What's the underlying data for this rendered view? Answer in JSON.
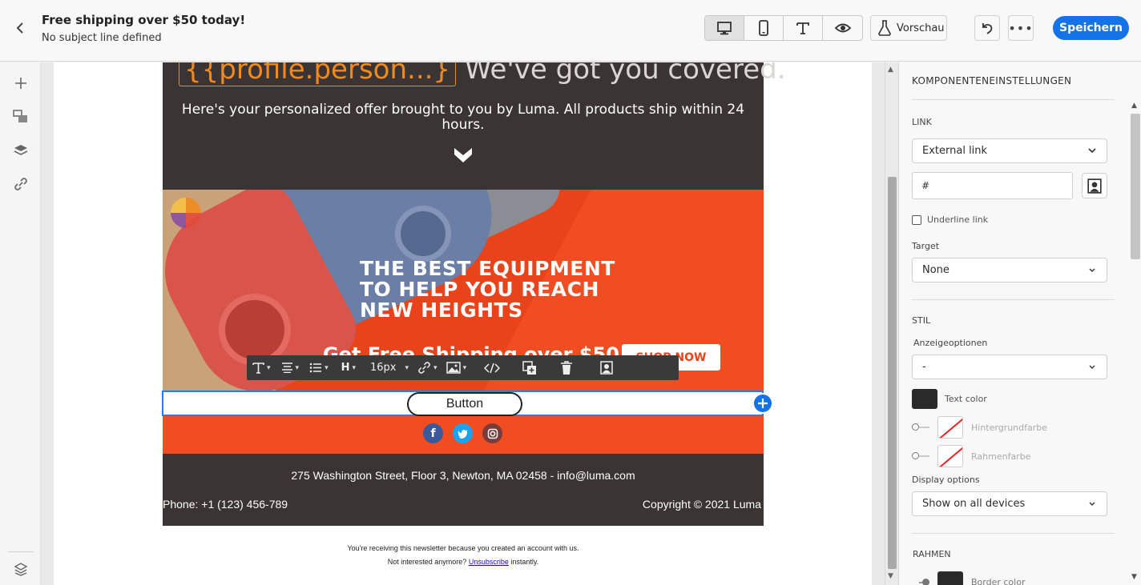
{
  "header": {
    "title": "Free shipping over $50 today!",
    "subtitle": "No subject line defined",
    "preview_label": "Vorschau",
    "save_label": "Speichern",
    "more_label": "•••"
  },
  "email": {
    "hero_personalization": "{{profile.person...}",
    "hero_headline_rest": "We've got you covered.",
    "hero_text": "Here's your personalized offer brought to you by Luma. All products ship within 24 hours.",
    "banner_headline_1": "THE BEST EQUIPMENT",
    "banner_headline_2": "TO HELP YOU REACH",
    "banner_headline_3": "NEW HEIGHTS",
    "banner_sub": "Get Free Shipping over $50",
    "banner_cta": "SHOP NOW",
    "button_label": "Button",
    "address": "275 Washington Street, Floor 3, Newton, MA 02458 - info@luma.com",
    "phone": "Phone: +1 (123) 456-789",
    "copyright": "Copyright © 2021 Luma",
    "note_1": "You're receiving this newsletter because you created an account with us.",
    "note_2_prefix": "Not interested anymore?",
    "note_2_link": "Unsubscribe",
    "note_2_suffix": "instantly."
  },
  "toolbar": {
    "heading": "H",
    "font_size": "16px"
  },
  "panel": {
    "title": "KOMPONENTENEINSTELLUNGEN",
    "link_section": "LINK",
    "link_type": "External link",
    "link_value": "#",
    "underline_label": "Underline link",
    "target_label": "Target",
    "target_value": "None",
    "style_section": "STIL",
    "display_options_de": "Anzeigeoptionen",
    "display_options_de_value": "-",
    "text_color_label": "Text color",
    "bg_color_label": "Hintergrundfarbe",
    "border_color_de_label": "Rahmenfarbe",
    "display_options_label": "Display options",
    "display_options_value": "Show on all devices",
    "border_section": "RAHMEN",
    "border_color_label": "Border color"
  },
  "colors": {
    "accent": "#1473e6",
    "dark": "#3a3534",
    "orange": "#f04d22"
  },
  "icons": {
    "back": "chevron-left-icon",
    "desktop": "desktop-icon",
    "mobile": "mobile-icon",
    "text": "text-icon",
    "eye": "eye-icon",
    "flask": "flask-icon",
    "undo": "undo-icon"
  }
}
